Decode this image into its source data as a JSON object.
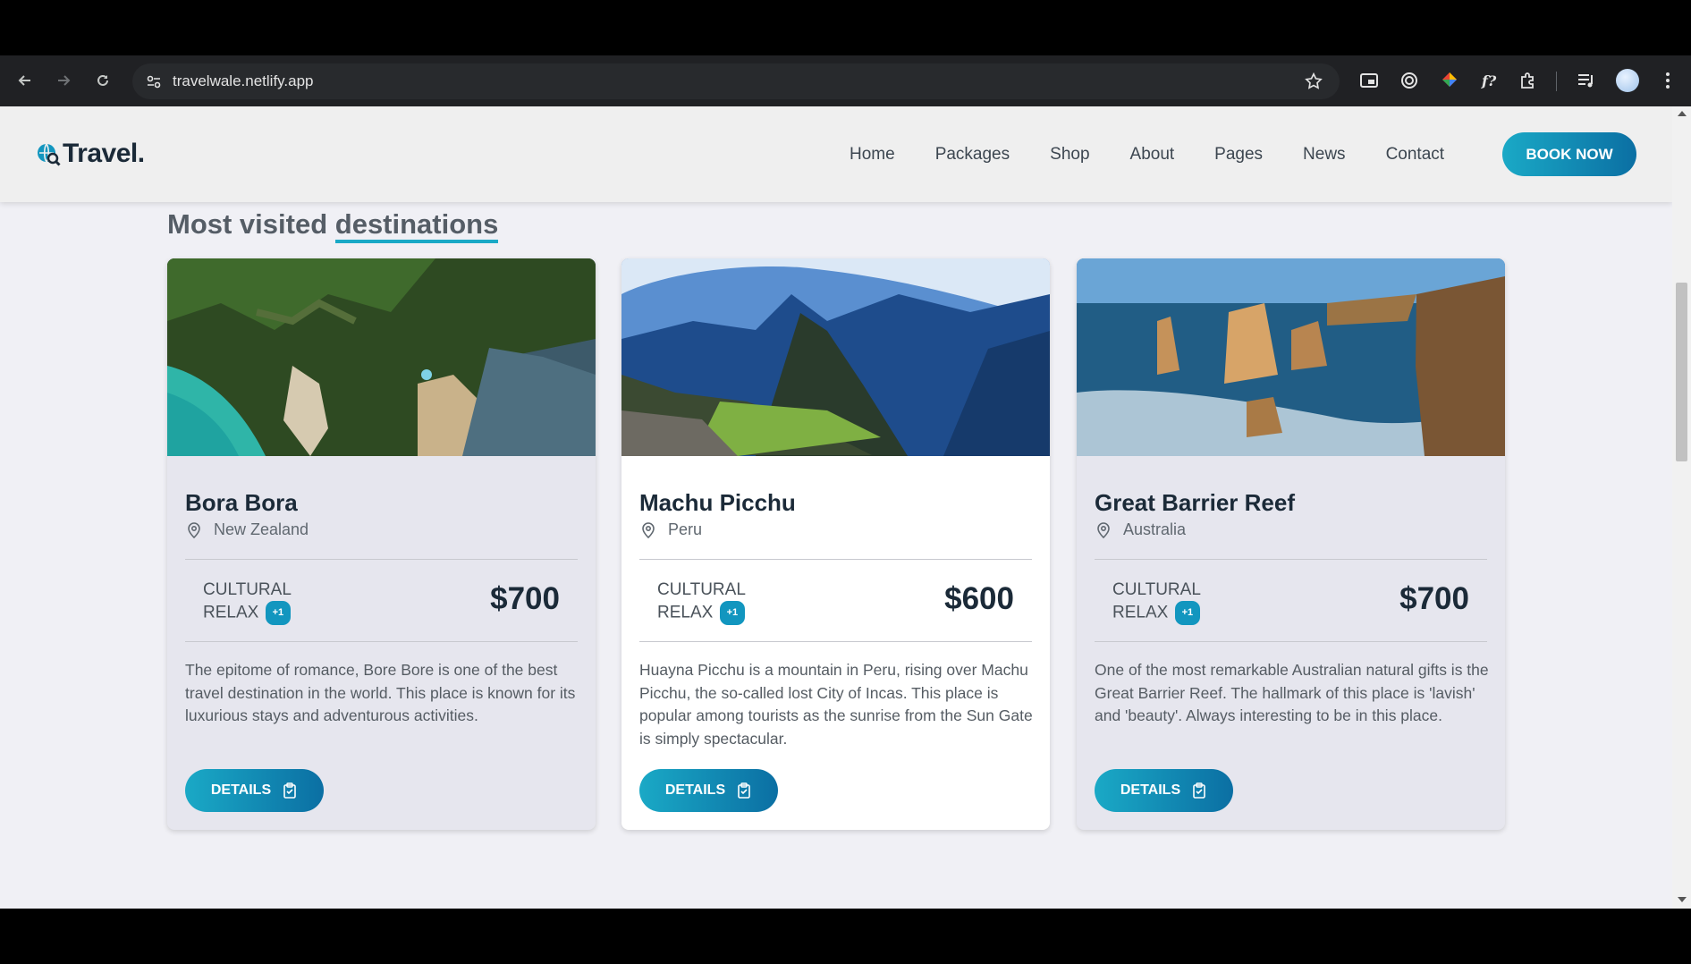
{
  "browser": {
    "url": "travelwale.netlify.app"
  },
  "header": {
    "logo_text": "Travel.",
    "nav": [
      "Home",
      "Packages",
      "Shop",
      "About",
      "Pages",
      "News",
      "Contact"
    ],
    "book_label": "BOOK NOW"
  },
  "section": {
    "title_part1": "Most visited ",
    "title_part2": "destinations"
  },
  "cards": [
    {
      "title": "Bora Bora",
      "location": "New Zealand",
      "tag1": "CULTURAL",
      "tag2": "RELAX",
      "badge": "+1",
      "price": "$700",
      "description": "The epitome of romance, Bore Bore is one of the best travel destination in the world. This place is known for its luxurious stays and adventurous activities.",
      "button": "DETAILS"
    },
    {
      "title": "Machu Picchu",
      "location": "Peru",
      "tag1": "CULTURAL",
      "tag2": "RELAX",
      "badge": "+1",
      "price": "$600",
      "description": "Huayna Picchu is a mountain in Peru, rising over Machu Picchu, the so-called lost City of Incas. This place is popular among tourists as the sunrise from the Sun Gate is simply spectacular.",
      "button": "DETAILS"
    },
    {
      "title": "Great Barrier Reef",
      "location": "Australia",
      "tag1": "CULTURAL",
      "tag2": "RELAX",
      "badge": "+1",
      "price": "$700",
      "description": "One of the most remarkable Australian natural gifts is the Great Barrier Reef. The hallmark of this place is 'lavish' and 'beauty'. Always interesting to be in this place.",
      "button": "DETAILS"
    }
  ],
  "colors": {
    "accent": "#1aa9c6",
    "accent_dark": "#0b6fa3",
    "heading": "#1b2a38"
  }
}
